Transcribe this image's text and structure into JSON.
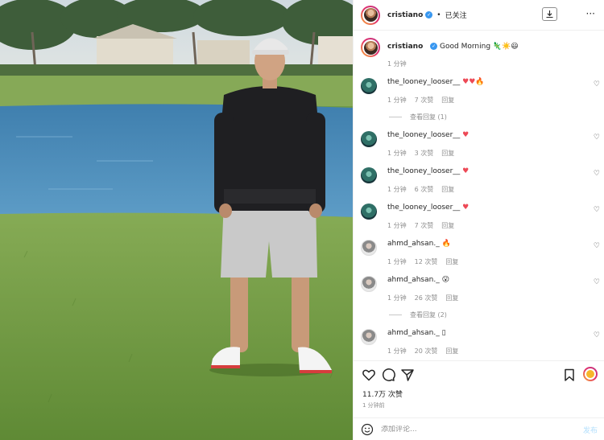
{
  "header": {
    "username": "cristiano",
    "follow_state": "已关注",
    "dot": "•"
  },
  "caption": {
    "username": "cristiano",
    "text": "Good Morning 🦎☀️😃",
    "time": "1 分钟"
  },
  "comments": [
    {
      "username": "the_looney_looser__",
      "text": "♥♥🔥",
      "time": "1 分钟",
      "likes": "7 次赞",
      "reply": "回复",
      "avatar": "teal"
    },
    {
      "username": "the_looney_looser__",
      "text": "♥",
      "time": "1 分钟",
      "likes": "3 次赞",
      "reply": "回复",
      "avatar": "teal"
    },
    {
      "username": "the_looney_looser__",
      "text": "♥",
      "time": "1 分钟",
      "likes": "6 次赞",
      "reply": "回复",
      "avatar": "teal"
    },
    {
      "username": "the_looney_looser__",
      "text": "♥",
      "time": "1 分钟",
      "likes": "7 次赞",
      "reply": "回复",
      "avatar": "teal"
    },
    {
      "username": "ahmd_ahsan._",
      "text": "🔥",
      "time": "1 分钟",
      "likes": "12 次赞",
      "reply": "回复",
      "avatar": "gray"
    },
    {
      "username": "ahmd_ahsan._",
      "text": "😮",
      "time": "1 分钟",
      "likes": "26 次赞",
      "reply": "回复",
      "avatar": "gray"
    },
    {
      "username": "ahmd_ahsan._",
      "text": "▯",
      "time": "1 分钟",
      "likes": "20 次赞",
      "reply": "回复",
      "avatar": "gray"
    }
  ],
  "view_replies": [
    {
      "label": "查看回复 (1)"
    },
    {
      "label": "查看回复 (2)"
    }
  ],
  "footer": {
    "likes": "11.7万 次赞",
    "time": "1 分钟前",
    "comment_placeholder": "添加评论...",
    "post_label": "发布"
  },
  "icons": {
    "header_action": "download-icon",
    "more": "more-horizontal-icon",
    "like": "heart-outline-icon",
    "comment": "comment-bubble-icon",
    "share": "send-arrow-icon",
    "save": "bookmark-icon",
    "emoji": "smiley-icon"
  },
  "colors": {
    "accent": "#3897f0",
    "heart": "#ed4956",
    "muted": "#8e8e8e",
    "post_button": "#b2dffc"
  }
}
